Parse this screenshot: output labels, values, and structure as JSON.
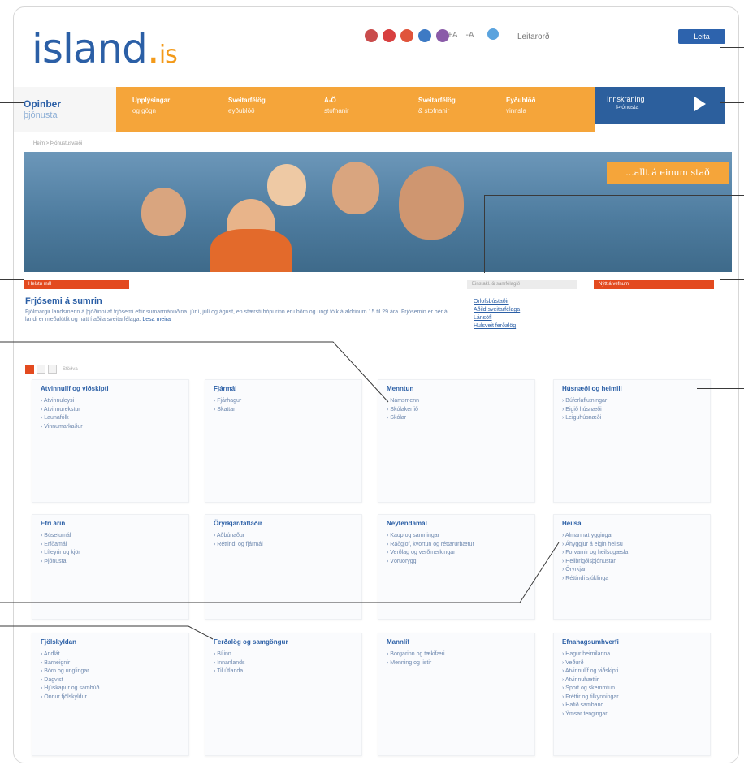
{
  "header": {
    "logo_text": "island",
    "logo_dot": ".",
    "logo_suffix": "is",
    "text_size_plus": "+A",
    "text_size_minus": "-A",
    "search_placeholder": "Leitarorð",
    "search_button": "Leita"
  },
  "nav": {
    "first": {
      "line1": "Opinber",
      "line2": "þjónusta"
    },
    "items": [
      {
        "line1": "Upplýsingar",
        "line2": "og gögn"
      },
      {
        "line1": "Sveitarfélög",
        "line2": "eyðublöð"
      },
      {
        "line1": "A-Ö",
        "line2": "stofnanir"
      },
      {
        "line1": "Sveitarfélög",
        "line2": "& stofnanir"
      },
      {
        "line1": "Eyðublöð",
        "line2": "vinnsla"
      }
    ],
    "blue": {
      "line1": "Innskráning",
      "line2": "Þjónusta"
    }
  },
  "breadcrumb": "Heim > Þjónustusvæði",
  "hero": {
    "slogan": "...allt á einum stað"
  },
  "bars": {
    "left": "Helstu mál",
    "grey": "Einstakl. & samfélagið",
    "right": "Nýtt á vefnum"
  },
  "feature": {
    "title": "Frjósemi á sumrin",
    "text": "Fjölmargir landsmenn á þjóðinni af frjósemi eftir sumarmánuðina, júní, júlí og ágúst, en stærsti hópurinn eru börn og ungt fólk á aldrinum 15 til 29 ára. Frjósemin er hér á landi er meðalútlit og hátt í aðila sveitarfélaga.",
    "more": "Lesa meira",
    "pager_label": "Stöðva"
  },
  "links": [
    "Orlofsbústaðir",
    "Aðild sveitarfélaga",
    "Lánsöfl",
    "Hulsveit ferðalög"
  ],
  "cards": [
    {
      "title": "Atvinnulíf og viðskipti",
      "items": [
        "Atvinnuleysi",
        "Atvinnurekstur",
        "Launafólk",
        "Vinnumarkaður"
      ]
    },
    {
      "title": "Fjármál",
      "items": [
        "Fjárhagur",
        "Skattar"
      ]
    },
    {
      "title": "Menntun",
      "items": [
        "Námsmenn",
        "Skólakerfið",
        "Skólar"
      ]
    },
    {
      "title": "Húsnæði og heimili",
      "items": [
        "Búferlaflutningar",
        "Eigið húsnæði",
        "Leiguhúsnæði"
      ]
    },
    {
      "title": "Efri árin",
      "items": [
        "Búsetumál",
        "Erfðamál",
        "Lífeyrir og kjör",
        "Þjónusta"
      ]
    },
    {
      "title": "Öryrkjar/fatlaðir",
      "items": [
        "Aðbúnaður",
        "Réttindi og fjármál"
      ]
    },
    {
      "title": "Neytendamál",
      "items": [
        "Kaup og samningar",
        "Ráðgjöf, kvörtun og réttarúrbætur",
        "Verðlag og verðmerkingar",
        "Vöruöryggi"
      ]
    },
    {
      "title": "Heilsa",
      "items": [
        "Almannatryggingar",
        "Áhyggjur á eigin heilsu",
        "Forvarnir og heilsugæsla",
        "Heilbrigðisþjónustan",
        "Öryrkjar",
        "Réttindi sjúklinga"
      ]
    },
    {
      "title": "Fjölskyldan",
      "items": [
        "Andlát",
        "Barneignir",
        "Börn og unglingar",
        "Dagvist",
        "Hjúskapur og sambúð",
        "Önnur fjölskyldur"
      ]
    },
    {
      "title": "Ferðalög og samgöngur",
      "items": [
        "Bílinn",
        "Innanlands",
        "Til útlanda"
      ]
    },
    {
      "title": "Mannlíf",
      "items": [
        "Borgarinn og tækifæri",
        "Menning og listir"
      ]
    },
    {
      "title": "Efnahagsumhverfi",
      "items": [
        "Hagur heimilanna",
        "Veðurð",
        "Atvinnulíf og viðskipti",
        "Atvinnuhættir",
        "Sport og skemmtun",
        "Fréttir og tilkynningar",
        "Hafið samband",
        "Ýmsar tengingar"
      ]
    }
  ],
  "colors": {
    "brand_blue": "#2b5fa6",
    "orange": "#f5a53a",
    "red": "#e34a1f",
    "dark_blue": "#2c5f9d"
  }
}
